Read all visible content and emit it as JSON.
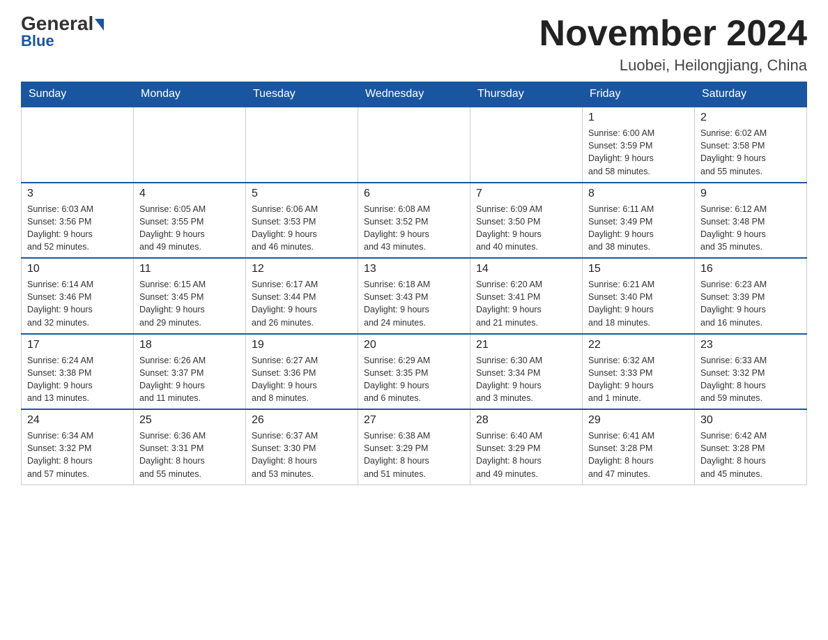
{
  "header": {
    "logo_general": "General",
    "logo_blue": "Blue",
    "title": "November 2024",
    "subtitle": "Luobei, Heilongjiang, China"
  },
  "weekdays": [
    "Sunday",
    "Monday",
    "Tuesday",
    "Wednesday",
    "Thursday",
    "Friday",
    "Saturday"
  ],
  "weeks": [
    [
      {
        "day": "",
        "info": "",
        "empty": true
      },
      {
        "day": "",
        "info": "",
        "empty": true
      },
      {
        "day": "",
        "info": "",
        "empty": true
      },
      {
        "day": "",
        "info": "",
        "empty": true
      },
      {
        "day": "",
        "info": "",
        "empty": true
      },
      {
        "day": "1",
        "info": "Sunrise: 6:00 AM\nSunset: 3:59 PM\nDaylight: 9 hours\nand 58 minutes."
      },
      {
        "day": "2",
        "info": "Sunrise: 6:02 AM\nSunset: 3:58 PM\nDaylight: 9 hours\nand 55 minutes."
      }
    ],
    [
      {
        "day": "3",
        "info": "Sunrise: 6:03 AM\nSunset: 3:56 PM\nDaylight: 9 hours\nand 52 minutes."
      },
      {
        "day": "4",
        "info": "Sunrise: 6:05 AM\nSunset: 3:55 PM\nDaylight: 9 hours\nand 49 minutes."
      },
      {
        "day": "5",
        "info": "Sunrise: 6:06 AM\nSunset: 3:53 PM\nDaylight: 9 hours\nand 46 minutes."
      },
      {
        "day": "6",
        "info": "Sunrise: 6:08 AM\nSunset: 3:52 PM\nDaylight: 9 hours\nand 43 minutes."
      },
      {
        "day": "7",
        "info": "Sunrise: 6:09 AM\nSunset: 3:50 PM\nDaylight: 9 hours\nand 40 minutes."
      },
      {
        "day": "8",
        "info": "Sunrise: 6:11 AM\nSunset: 3:49 PM\nDaylight: 9 hours\nand 38 minutes."
      },
      {
        "day": "9",
        "info": "Sunrise: 6:12 AM\nSunset: 3:48 PM\nDaylight: 9 hours\nand 35 minutes."
      }
    ],
    [
      {
        "day": "10",
        "info": "Sunrise: 6:14 AM\nSunset: 3:46 PM\nDaylight: 9 hours\nand 32 minutes."
      },
      {
        "day": "11",
        "info": "Sunrise: 6:15 AM\nSunset: 3:45 PM\nDaylight: 9 hours\nand 29 minutes."
      },
      {
        "day": "12",
        "info": "Sunrise: 6:17 AM\nSunset: 3:44 PM\nDaylight: 9 hours\nand 26 minutes."
      },
      {
        "day": "13",
        "info": "Sunrise: 6:18 AM\nSunset: 3:43 PM\nDaylight: 9 hours\nand 24 minutes."
      },
      {
        "day": "14",
        "info": "Sunrise: 6:20 AM\nSunset: 3:41 PM\nDaylight: 9 hours\nand 21 minutes."
      },
      {
        "day": "15",
        "info": "Sunrise: 6:21 AM\nSunset: 3:40 PM\nDaylight: 9 hours\nand 18 minutes."
      },
      {
        "day": "16",
        "info": "Sunrise: 6:23 AM\nSunset: 3:39 PM\nDaylight: 9 hours\nand 16 minutes."
      }
    ],
    [
      {
        "day": "17",
        "info": "Sunrise: 6:24 AM\nSunset: 3:38 PM\nDaylight: 9 hours\nand 13 minutes."
      },
      {
        "day": "18",
        "info": "Sunrise: 6:26 AM\nSunset: 3:37 PM\nDaylight: 9 hours\nand 11 minutes."
      },
      {
        "day": "19",
        "info": "Sunrise: 6:27 AM\nSunset: 3:36 PM\nDaylight: 9 hours\nand 8 minutes."
      },
      {
        "day": "20",
        "info": "Sunrise: 6:29 AM\nSunset: 3:35 PM\nDaylight: 9 hours\nand 6 minutes."
      },
      {
        "day": "21",
        "info": "Sunrise: 6:30 AM\nSunset: 3:34 PM\nDaylight: 9 hours\nand 3 minutes."
      },
      {
        "day": "22",
        "info": "Sunrise: 6:32 AM\nSunset: 3:33 PM\nDaylight: 9 hours\nand 1 minute."
      },
      {
        "day": "23",
        "info": "Sunrise: 6:33 AM\nSunset: 3:32 PM\nDaylight: 8 hours\nand 59 minutes."
      }
    ],
    [
      {
        "day": "24",
        "info": "Sunrise: 6:34 AM\nSunset: 3:32 PM\nDaylight: 8 hours\nand 57 minutes."
      },
      {
        "day": "25",
        "info": "Sunrise: 6:36 AM\nSunset: 3:31 PM\nDaylight: 8 hours\nand 55 minutes."
      },
      {
        "day": "26",
        "info": "Sunrise: 6:37 AM\nSunset: 3:30 PM\nDaylight: 8 hours\nand 53 minutes."
      },
      {
        "day": "27",
        "info": "Sunrise: 6:38 AM\nSunset: 3:29 PM\nDaylight: 8 hours\nand 51 minutes."
      },
      {
        "day": "28",
        "info": "Sunrise: 6:40 AM\nSunset: 3:29 PM\nDaylight: 8 hours\nand 49 minutes."
      },
      {
        "day": "29",
        "info": "Sunrise: 6:41 AM\nSunset: 3:28 PM\nDaylight: 8 hours\nand 47 minutes."
      },
      {
        "day": "30",
        "info": "Sunrise: 6:42 AM\nSunset: 3:28 PM\nDaylight: 8 hours\nand 45 minutes."
      }
    ]
  ]
}
